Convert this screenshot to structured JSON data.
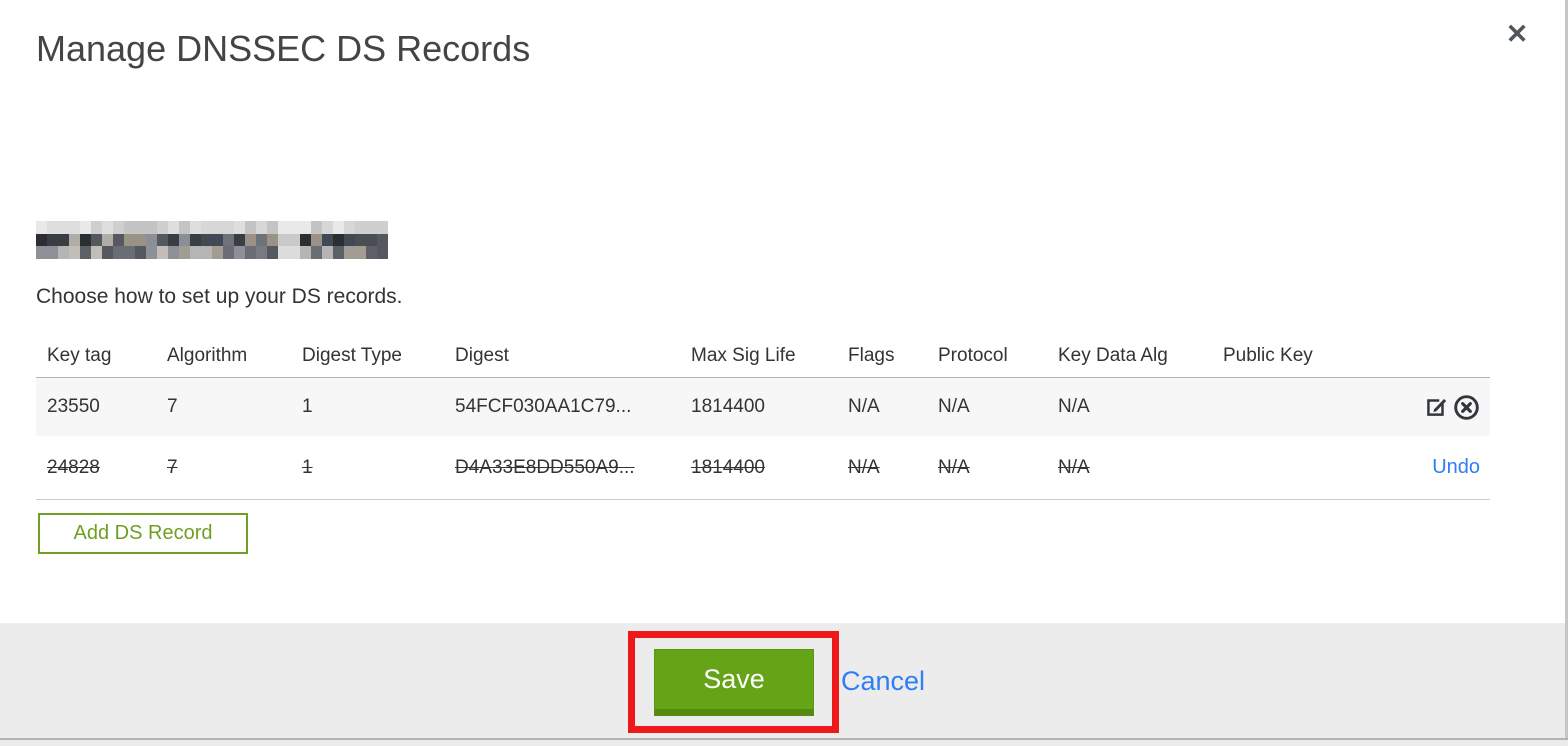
{
  "modal": {
    "title": "Manage DNSSEC DS Records",
    "close_glyph": "✕",
    "instruction": "Choose how to set up your DS records.",
    "domain_redacted": true
  },
  "table": {
    "columns": [
      "Key tag",
      "Algorithm",
      "Digest Type",
      "Digest",
      "Max Sig Life",
      "Flags",
      "Protocol",
      "Key Data Alg",
      "Public Key"
    ],
    "rows": [
      {
        "key_tag": "23550",
        "algorithm": "7",
        "digest_type": "1",
        "digest": "54FCF030AA1C79...",
        "max_sig_life": "1814400",
        "flags": "N/A",
        "protocol": "N/A",
        "key_data_alg": "N/A",
        "public_key": "",
        "state": "normal",
        "actions": [
          "edit-icon",
          "remove-icon"
        ]
      },
      {
        "key_tag": "24828",
        "algorithm": "7",
        "digest_type": "1",
        "digest": "D4A33E8DD550A9...",
        "max_sig_life": "1814400",
        "flags": "N/A",
        "protocol": "N/A",
        "key_data_alg": "N/A",
        "public_key": "",
        "state": "deleted",
        "action_label": "Undo"
      }
    ]
  },
  "buttons": {
    "add_ds_record": "Add DS Record",
    "save": "Save",
    "cancel": "Cancel"
  },
  "annotations": {
    "save_highlight": "red-rectangle"
  },
  "colors": {
    "button_green": "#65a317",
    "button_green_dark": "#55890f",
    "outline_green": "#6f9f23",
    "link_blue": "#2d7ef7",
    "annotation_red": "#ee1a1a",
    "footer_bg": "#ececec",
    "row_shaded_bg": "#f7f7f7",
    "text": "#333333"
  }
}
